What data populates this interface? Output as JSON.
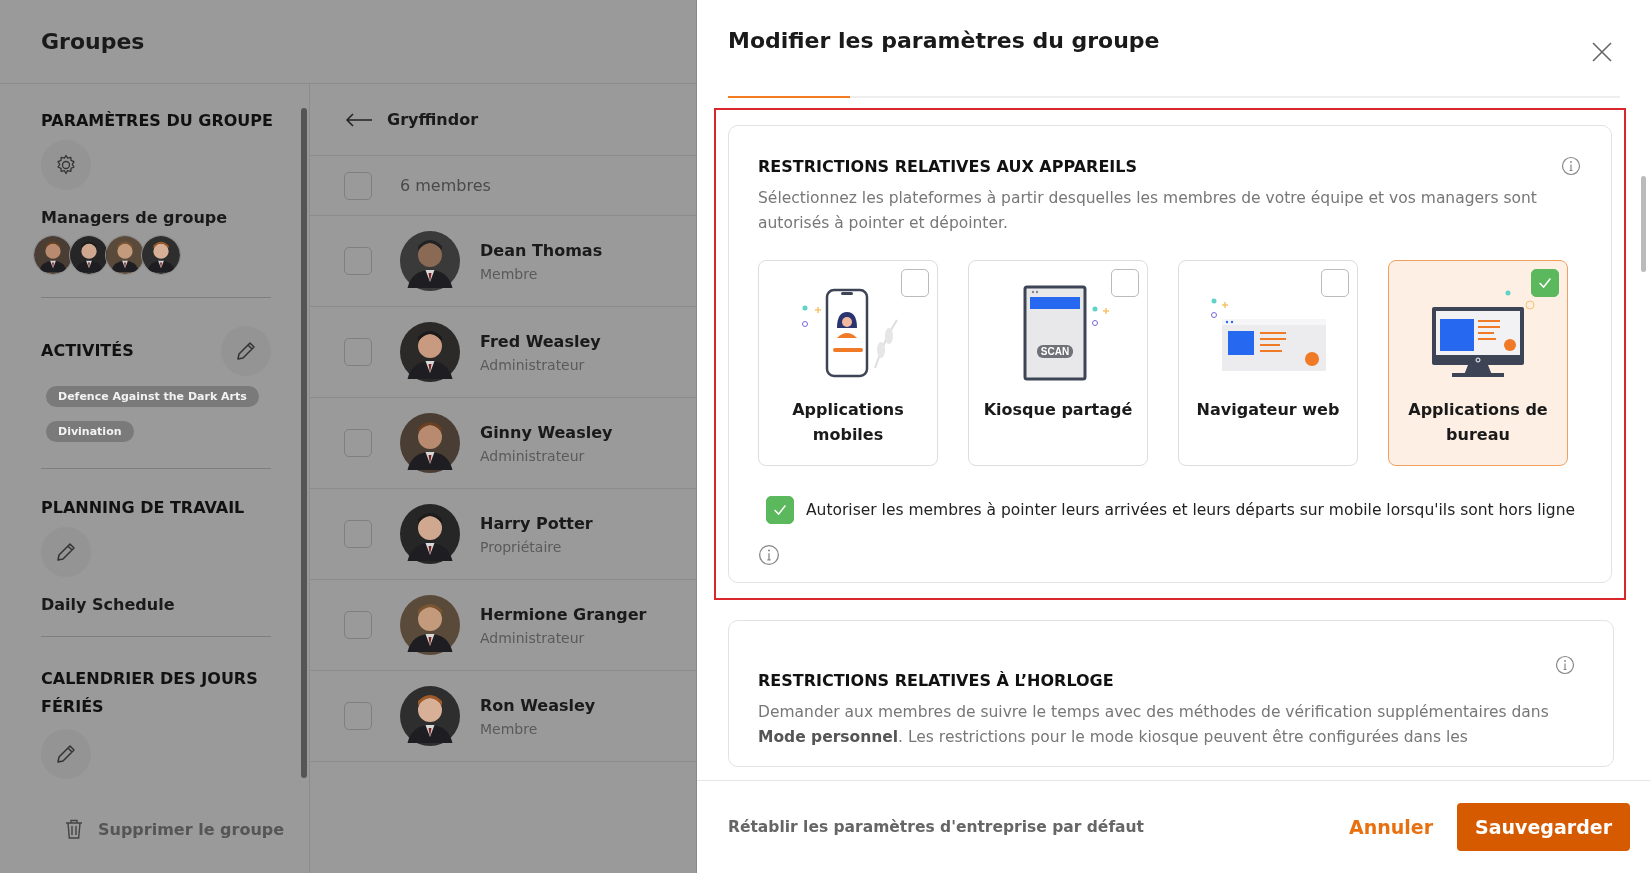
{
  "header": {
    "title": "Groupes"
  },
  "settings": {
    "title": "PARAMÈTRES DU GROUPE",
    "managers_label": "Managers de groupe"
  },
  "activities": {
    "title": "ACTIVITÉS",
    "tags": [
      "Defence Against the Dark Arts",
      "Divination"
    ]
  },
  "schedule": {
    "title": "PLANNING DE TRAVAIL",
    "value": "Daily Schedule"
  },
  "holidays": {
    "title": "CALENDRIER DES JOURS FÉRIÉS"
  },
  "delete_label": "Supprimer le groupe",
  "members": {
    "group_name": "Gryffindor",
    "count_label": "6 membres",
    "all_checked": false,
    "rows": [
      {
        "name": "Dean Thomas",
        "role": "Membre",
        "checked": false
      },
      {
        "name": "Fred Weasley",
        "role": "Administrateur",
        "checked": false
      },
      {
        "name": "Ginny Weasley",
        "role": "Administrateur",
        "checked": false
      },
      {
        "name": "Harry Potter",
        "role": "Propriétaire",
        "checked": false
      },
      {
        "name": "Hermione Granger",
        "role": "Administrateur",
        "checked": false
      },
      {
        "name": "Ron Weasley",
        "role": "Membre",
        "checked": false
      }
    ]
  },
  "dialog": {
    "title": "Modifier les paramètres du groupe",
    "device_section": {
      "title": "RESTRICTIONS RELATIVES AUX APPAREILS",
      "description": "Sélectionnez les plateformes à partir desquelles les membres de votre équipe et vos managers sont autorisés à pointer et dépointer.",
      "options": [
        {
          "kind": "mobile",
          "label": "Applications mobiles",
          "selected": false
        },
        {
          "kind": "kiosk",
          "label": "Kiosque partagé",
          "selected": false,
          "screen_text": "SCAN"
        },
        {
          "kind": "browser",
          "label": "Navigateur web",
          "selected": false
        },
        {
          "kind": "desktop",
          "label": "Applications de bureau",
          "selected": true
        }
      ],
      "offline": {
        "label": "Autoriser les membres à pointer leurs arrivées et leurs départs sur mobile lorsqu'ils sont hors ligne",
        "checked": true
      }
    },
    "clock_section": {
      "title": "RESTRICTIONS RELATIVES À L’HORLOGE",
      "description": "Demander aux membres de suivre le temps avec des méthodes de vérification supplémentaires dans **Mode personnel**. Les restrictions pour le mode kiosque peuvent être configurées dans les"
    },
    "footer": {
      "reset": "Rétablir les paramètres d'entreprise par défaut",
      "cancel": "Annuler",
      "save": "Sauvegarder"
    }
  }
}
